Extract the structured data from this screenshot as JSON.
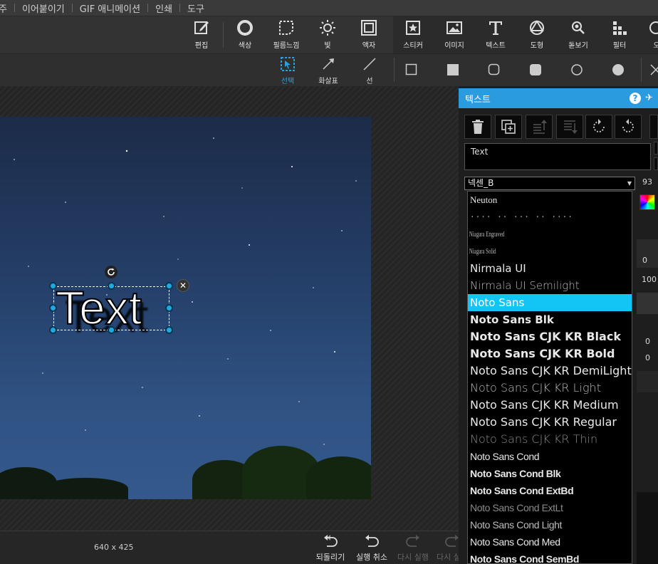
{
  "menubar": {
    "items": [
      "주",
      "이어붙이기",
      "GIF 애니메이션",
      "인쇄",
      "도구"
    ]
  },
  "toolbar": {
    "tools": [
      {
        "label": "편집",
        "icon": "edit-icon"
      },
      {
        "label": "색상",
        "icon": "color-circle-icon"
      },
      {
        "label": "필름느낌",
        "icon": "film-icon"
      },
      {
        "label": "빛",
        "icon": "sun-icon"
      },
      {
        "label": "액자",
        "icon": "frame-icon"
      },
      {
        "label": "스티커",
        "icon": "sticker-icon"
      },
      {
        "label": "이미지",
        "icon": "image-icon"
      },
      {
        "label": "텍스트",
        "icon": "text-icon"
      },
      {
        "label": "도형",
        "icon": "shape-icon"
      },
      {
        "label": "돋보기",
        "icon": "magnifier-icon"
      },
      {
        "label": "필터",
        "icon": "filter-icon"
      },
      {
        "label": "오",
        "icon": "partial-icon"
      }
    ]
  },
  "toolbar2": {
    "tools": [
      {
        "label": "선택",
        "icon": "select-icon"
      },
      {
        "label": "화살표",
        "icon": "arrow-icon"
      },
      {
        "label": "선",
        "icon": "line-icon"
      }
    ],
    "shapes": [
      "square-outline-icon",
      "square-filled-icon",
      "rounded-square-outline-icon",
      "rounded-square-filled-icon",
      "circle-outline-icon",
      "circle-filled-icon"
    ]
  },
  "canvas": {
    "text_object": "Text",
    "image_size": "640 x 425"
  },
  "history": {
    "undo_all": "되돌리기",
    "undo": "실행 취소",
    "redo": "다시 실행",
    "redo_all": "다시 실"
  },
  "panel": {
    "title": "텍스트",
    "text_value": "Text",
    "font_selected": "넥센_B",
    "font_size": "93",
    "side_values": {
      "a": "0",
      "b": "100",
      "c": "0",
      "d": "0"
    },
    "fonts": [
      {
        "name": "Neuton",
        "style": "serif",
        "weight": "normal",
        "size": 13
      },
      {
        "name": "···· ·· ··· ·· ····",
        "style": "dots",
        "weight": "normal",
        "size": 11
      },
      {
        "name": "Niagara Engraved",
        "style": "narrow",
        "weight": "normal",
        "size": 11
      },
      {
        "name": "Niagara Solid",
        "style": "narrow",
        "weight": "normal",
        "size": 11
      },
      {
        "name": "Nirmala UI",
        "style": "sans",
        "weight": "normal",
        "size": 15
      },
      {
        "name": "Nirmala UI Semilight",
        "style": "sans",
        "weight": "light",
        "size": 15
      },
      {
        "name": "Noto Sans",
        "style": "sans",
        "weight": "normal",
        "size": 15,
        "selected": true
      },
      {
        "name": "Noto Sans Blk",
        "style": "sans",
        "weight": "bold",
        "size": 15
      },
      {
        "name": "Noto Sans CJK KR Black",
        "style": "sans",
        "weight": "bold",
        "size": 16
      },
      {
        "name": "Noto Sans CJK KR Bold",
        "style": "sans",
        "weight": "bold",
        "size": 16
      },
      {
        "name": "Noto Sans CJK KR DemiLight",
        "style": "sans",
        "weight": "normal",
        "size": 16
      },
      {
        "name": "Noto Sans CJK KR Light",
        "style": "sans",
        "weight": "light",
        "size": 16
      },
      {
        "name": "Noto Sans CJK KR Medium",
        "style": "sans",
        "weight": "medium",
        "size": 16
      },
      {
        "name": "Noto Sans CJK KR Regular",
        "style": "sans",
        "weight": "normal",
        "size": 16
      },
      {
        "name": "Noto Sans CJK KR Thin",
        "style": "sans",
        "weight": "thin",
        "size": 16
      },
      {
        "name": "Noto Sans Cond",
        "style": "cond",
        "weight": "normal",
        "size": 14
      },
      {
        "name": "Noto Sans Cond Blk",
        "style": "cond",
        "weight": "bold",
        "size": 14
      },
      {
        "name": "Noto Sans Cond ExtBd",
        "style": "cond",
        "weight": "bold",
        "size": 14
      },
      {
        "name": "Noto Sans Cond ExtLt",
        "style": "cond",
        "weight": "thin",
        "size": 14
      },
      {
        "name": "Noto Sans Cond Light",
        "style": "cond",
        "weight": "light",
        "size": 14
      },
      {
        "name": "Noto Sans Cond Med",
        "style": "cond",
        "weight": "medium",
        "size": 14
      },
      {
        "name": "Noto Sans Cond SemBd",
        "style": "cond",
        "weight": "bold",
        "size": 14
      }
    ]
  },
  "colors": {
    "accent": "#2b9be0",
    "selected_font_bg": "#12c5f5",
    "handle": "#1ea9e1"
  }
}
